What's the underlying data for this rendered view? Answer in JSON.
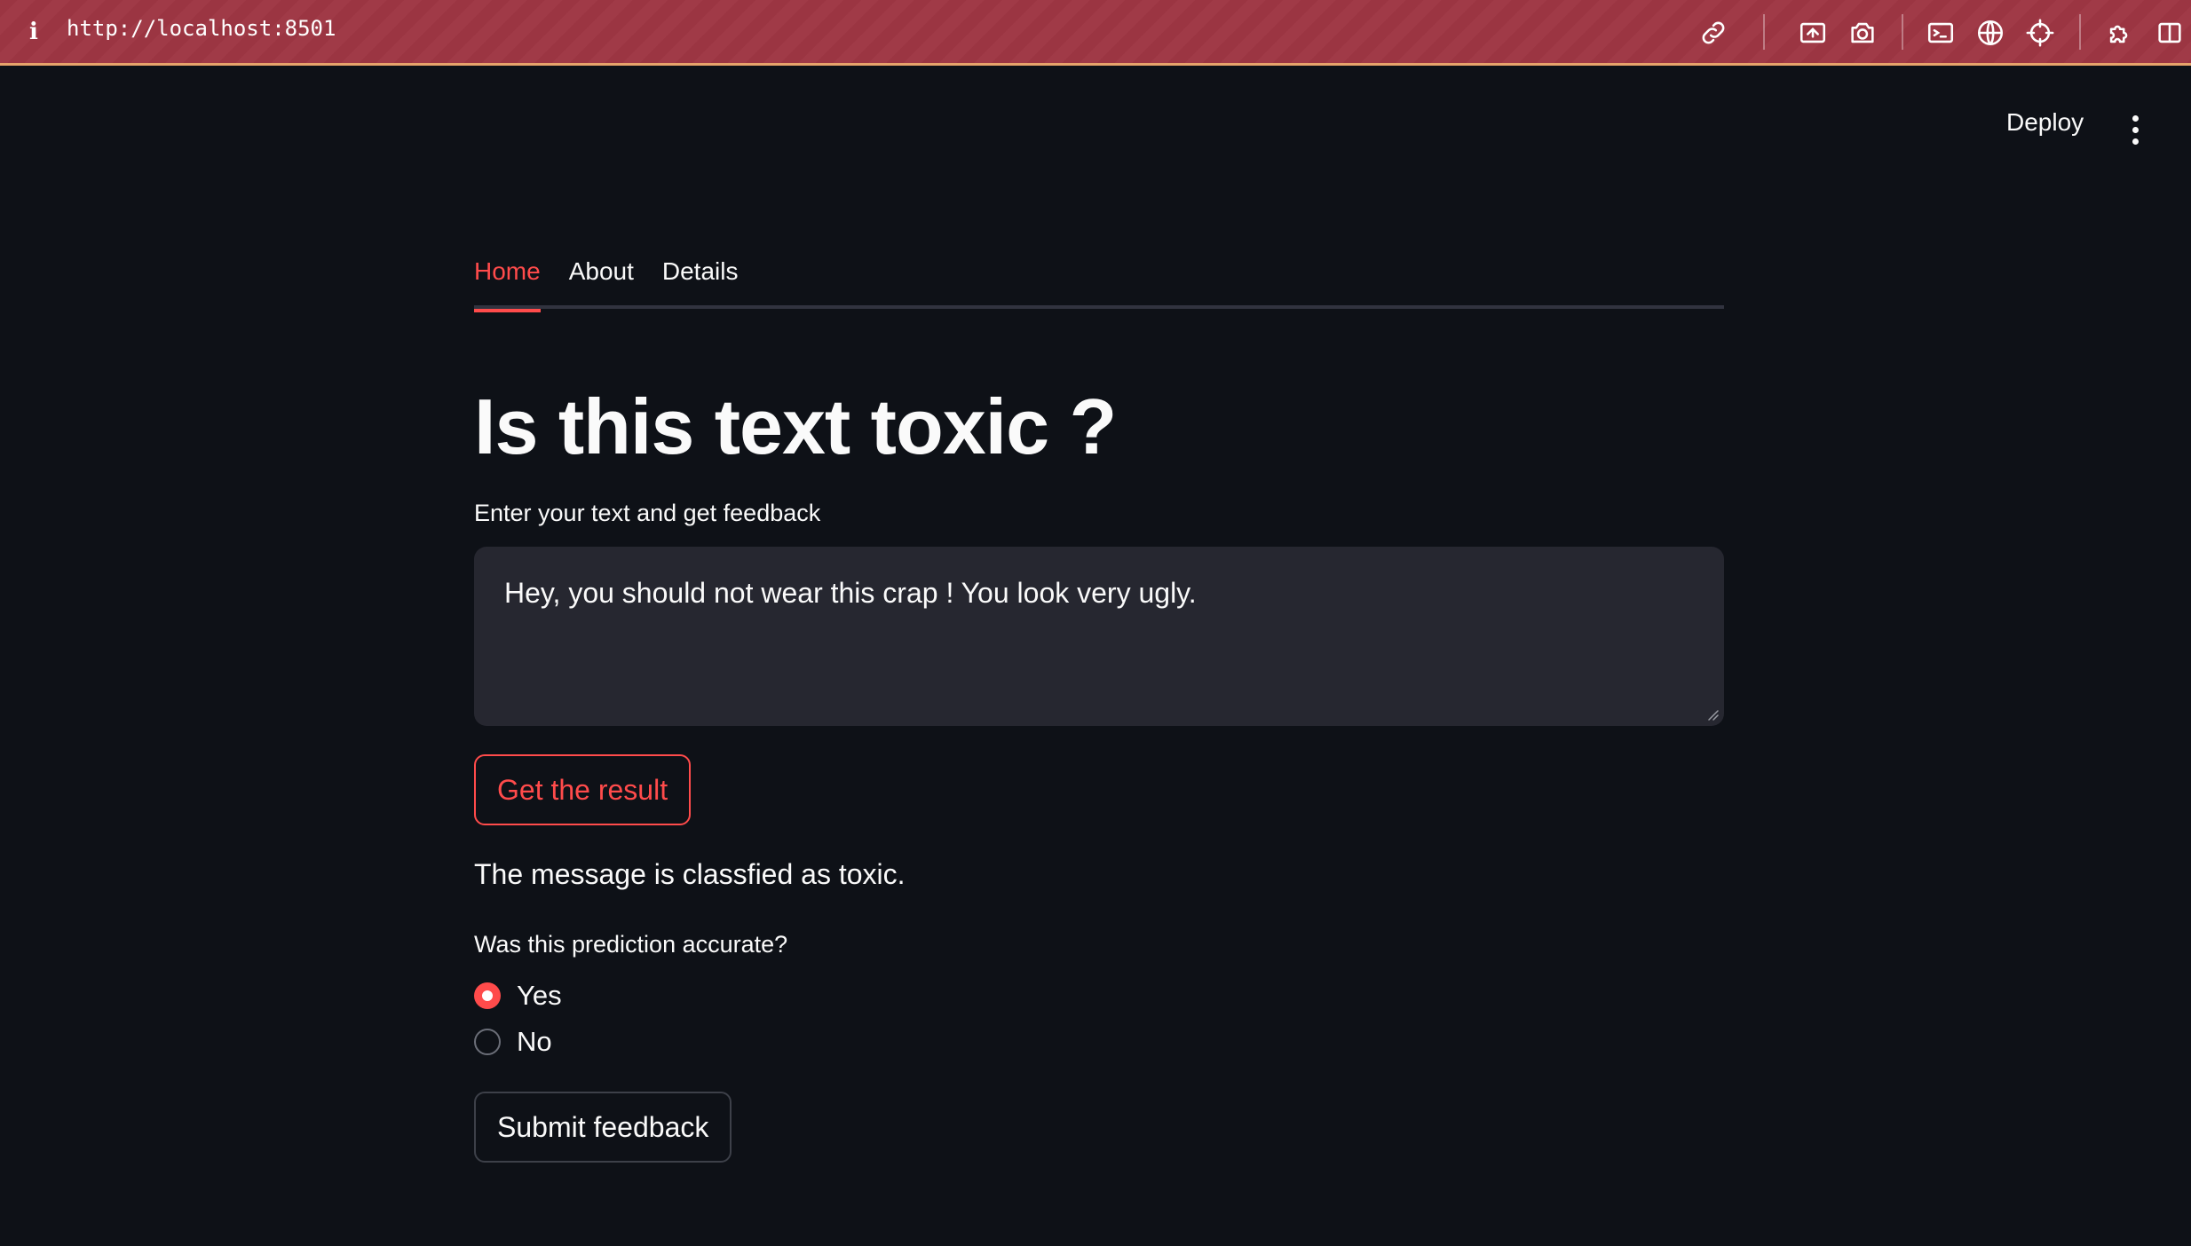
{
  "browser": {
    "url": "http://localhost:8501",
    "toolbar_icons": [
      "link-icon",
      "screenshot-region-icon",
      "camera-icon",
      "terminal-icon",
      "globe-icon",
      "crosshair-icon",
      "extensions-icon",
      "sidebar-toggle-icon"
    ]
  },
  "header": {
    "deploy_label": "Deploy"
  },
  "tabs": [
    {
      "label": "Home",
      "active": true
    },
    {
      "label": "About",
      "active": false
    },
    {
      "label": "Details",
      "active": false
    }
  ],
  "main": {
    "title": "Is this text toxic ?",
    "input_label": "Enter your text and get feedback",
    "input_value": "Hey, you should not wear this crap ! You look very ugly.",
    "get_result_label": "Get the result",
    "result_text": "The message is classfied as toxic.",
    "feedback": {
      "question": "Was this prediction accurate?",
      "options": [
        {
          "label": "Yes",
          "selected": true
        },
        {
          "label": "No",
          "selected": false
        }
      ],
      "submit_label": "Submit feedback"
    }
  },
  "colors": {
    "accent": "#ff4b4b",
    "background": "#0e1117",
    "input_bg": "#262730",
    "chrome_bar": "#9b3542"
  }
}
